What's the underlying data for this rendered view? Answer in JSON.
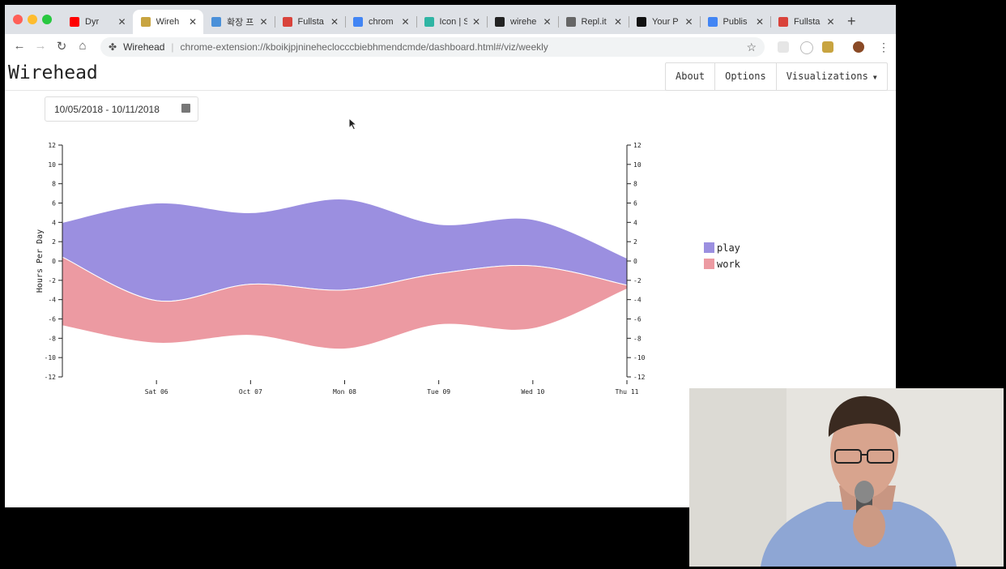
{
  "browser": {
    "tabs": [
      {
        "label": "Dyr",
        "icon": "youtube-icon",
        "color": "#ff0000"
      },
      {
        "label": "Wireh",
        "icon": "wirehead-icon",
        "color": "#c8a440",
        "active": true
      },
      {
        "label": "확장 프",
        "icon": "puzzle-icon",
        "color": "#4a90d9"
      },
      {
        "label": "Fullsta",
        "icon": "diamond-icon",
        "color": "#d9433b"
      },
      {
        "label": "chrom",
        "icon": "chrome-icon",
        "color": "#4285f4"
      },
      {
        "label": "Icon | S",
        "icon": "s-icon",
        "color": "#2fb5a4"
      },
      {
        "label": "wirehe",
        "icon": "github-icon",
        "color": "#222222"
      },
      {
        "label": "Repl.it",
        "icon": "replit-icon",
        "color": "#666666"
      },
      {
        "label": "Your P",
        "icon": "medium-icon",
        "color": "#111111"
      },
      {
        "label": "Publis",
        "icon": "chrome-icon",
        "color": "#4285f4"
      },
      {
        "label": "Fullsta",
        "icon": "diamond-icon",
        "color": "#d9433b"
      }
    ],
    "site_name": "Wirehead",
    "url": "chrome-extension://kboikjpjnineheclocccbiebhmendcmde/dashboard.html#/viz/weekly"
  },
  "app": {
    "brand": "Wirehead",
    "nav": {
      "about": "About",
      "options": "Options",
      "visualizations": "Visualizations"
    },
    "date_range": "10/05/2018 - 10/11/2018"
  },
  "chart_data": {
    "type": "area",
    "ylabel": "Hours Per Day",
    "ylim": [
      -12,
      12
    ],
    "yticks": [
      12,
      10,
      8,
      6,
      4,
      2,
      0,
      -2,
      -4,
      -6,
      -8,
      -10,
      -12
    ],
    "x": [
      "",
      "Sat 06",
      "Oct 07",
      "Mon 08",
      "Tue 09",
      "Wed 10",
      "Thu 11"
    ],
    "series": [
      {
        "name": "play",
        "color": "#9b8fe0",
        "upper": [
          4,
          6,
          5,
          6.4,
          3.8,
          4.3,
          0.3
        ],
        "lower": [
          0.4,
          -4.1,
          -2.4,
          -3,
          -1.3,
          -0.5,
          -2.5
        ]
      },
      {
        "name": "work",
        "color": "#ec9aa2",
        "upper": [
          0.4,
          -4.1,
          -2.4,
          -3,
          -1.3,
          -0.5,
          -2.5
        ],
        "lower": [
          -6.7,
          -8.5,
          -7.7,
          -9.1,
          -6.6,
          -7,
          -2.9
        ]
      }
    ],
    "legend_position": "right"
  }
}
